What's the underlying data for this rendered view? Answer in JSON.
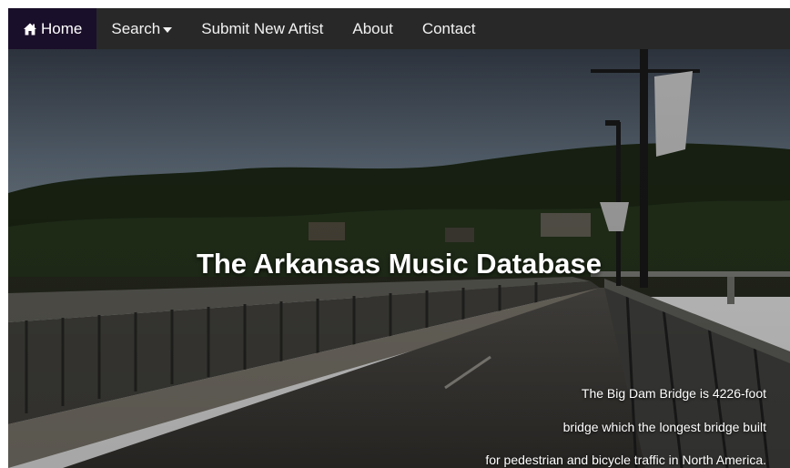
{
  "nav": {
    "home": "Home",
    "search": "Search",
    "submit": "Submit New Artist",
    "about": "About",
    "contact": "Contact"
  },
  "hero": {
    "title": "The Arkansas Music Database",
    "caption_lines": [
      "The Big Dam Bridge is 4226-foot",
      "bridge which the longest bridge built",
      "for pedestrian and bicycle traffic in North America."
    ]
  },
  "colors": {
    "navbar": "#282828",
    "active": "#1a0f2a"
  },
  "icons": {
    "home": "home-icon",
    "dropdown": "caret-down-icon"
  }
}
